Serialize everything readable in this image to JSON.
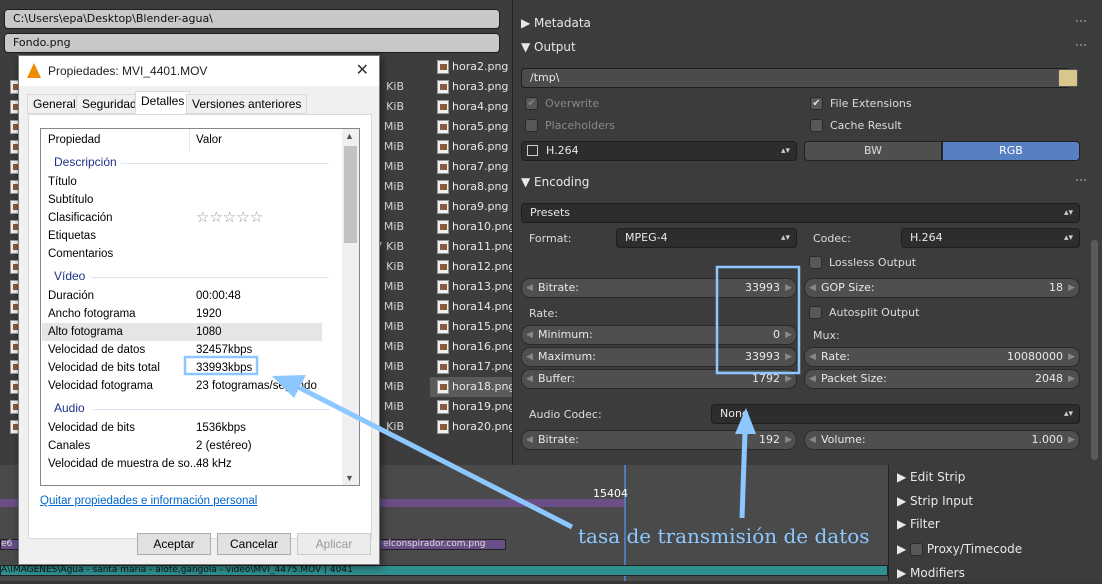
{
  "file_browser": {
    "path": "C:\\Users\\epa\\Desktop\\Blender-agua\\",
    "filename": "Fondo.png",
    "left_sizes": [
      "KiB",
      "KiB",
      "MiB",
      "MiB",
      "MiB",
      "MiB",
      "MiB",
      "MiB",
      "7 KiB",
      "KiB",
      "MiB",
      "MiB",
      "MiB",
      "MiB",
      "MiB",
      "MiB",
      "MiB",
      "KiB"
    ],
    "files": [
      "hora2.png",
      "hora3.png",
      "hora4.png",
      "hora5.png",
      "hora6.png",
      "hora7.png",
      "hora8.png",
      "hora9.png",
      "hora10.png",
      "hora11.png",
      "hora12.png",
      "hora13.png",
      "hora14.png",
      "hora15.png",
      "hora16.png",
      "hora17.png",
      "hora18.png",
      "hora19.png",
      "hora20.png"
    ],
    "selected_file": "hora18.png"
  },
  "properties_panel": {
    "metadata_label": "Metadata",
    "output_label": "Output",
    "output_path": "/tmp\\",
    "overwrite": "Overwrite",
    "file_extensions": "File Extensions",
    "placeholders": "Placeholders",
    "cache_result": "Cache Result",
    "format_value": "H.264",
    "bw": "BW",
    "rgb": "RGB",
    "encoding_label": "Encoding",
    "presets": "Presets",
    "format_label": "Format:",
    "format_select": "MPEG-4",
    "codec_label": "Codec:",
    "codec_select": "H.264",
    "lossless": "Lossless Output",
    "bitrate_label": "Bitrate:",
    "bitrate_value": "33993",
    "gop_label": "GOP Size:",
    "gop_value": "18",
    "autosplit": "Autosplit Output",
    "rate_label": "Rate:",
    "mux_label": "Mux:",
    "minimum_label": "Minimum:",
    "minimum_value": "0",
    "maximum_label": "Maximum:",
    "maximum_value": "33993",
    "mux_rate_label": "Rate:",
    "mux_rate_value": "10080000",
    "buffer_label": "Buffer:",
    "buffer_value": "1792",
    "packet_label": "Packet Size:",
    "packet_value": "2048",
    "audio_codec_label": "Audio Codec:",
    "audio_codec_value": "None",
    "audio_bitrate_label": "Bitrate:",
    "audio_bitrate_value": "192",
    "volume_label": "Volume:",
    "volume_value": "1.000"
  },
  "sequencer": {
    "frame_number": "15404",
    "strip1": "e6",
    "strip2": "elconspirador.com.png",
    "strip3": "A\\IMAGENES\\Agua - santa maria - alote,gangola - video\\MVI_4475.MOV | 4041"
  },
  "seq_side": {
    "edit_strip": "Edit Strip",
    "strip_input": "Strip Input",
    "filter": "Filter",
    "proxy": "Proxy/Timecode",
    "modifiers": "Modifiers"
  },
  "dialog": {
    "title": "Propiedades: MVI_4401.MOV",
    "tabs": [
      "General",
      "Seguridad",
      "Detalles",
      "Versiones anteriores"
    ],
    "col_property": "Propiedad",
    "col_value": "Valor",
    "sect_description": "Descripción",
    "titulo": "Título",
    "subtitulo": "Subtítulo",
    "clasificacion": "Clasificación",
    "stars": "☆☆☆☆☆",
    "etiquetas": "Etiquetas",
    "comentarios": "Comentarios",
    "sect_video": "Vídeo",
    "duracion": "Duración",
    "duracion_v": "00:00:48",
    "ancho": "Ancho fotograma",
    "ancho_v": "1920",
    "alto": "Alto fotograma",
    "alto_v": "1080",
    "vel_datos": "Velocidad de datos",
    "vel_datos_v": "32457kbps",
    "vel_total": "Velocidad de bits total",
    "vel_total_v": "33993kbps",
    "vel_foto": "Velocidad fotograma",
    "vel_foto_v": "23 fotogramas/segundo",
    "sect_audio": "Audio",
    "vel_bits": "Velocidad de bits",
    "vel_bits_v": "1536kbps",
    "canales": "Canales",
    "canales_v": "2 (estéreo)",
    "muestra": "Velocidad de muestra de so...",
    "muestra_v": "48 kHz",
    "link": "Quitar propiedades e información personal",
    "ok": "Aceptar",
    "cancel": "Cancelar",
    "apply": "Aplicar"
  },
  "annotation": {
    "text": "tasa de transmisión de datos",
    "color": "#8cc8ff"
  }
}
